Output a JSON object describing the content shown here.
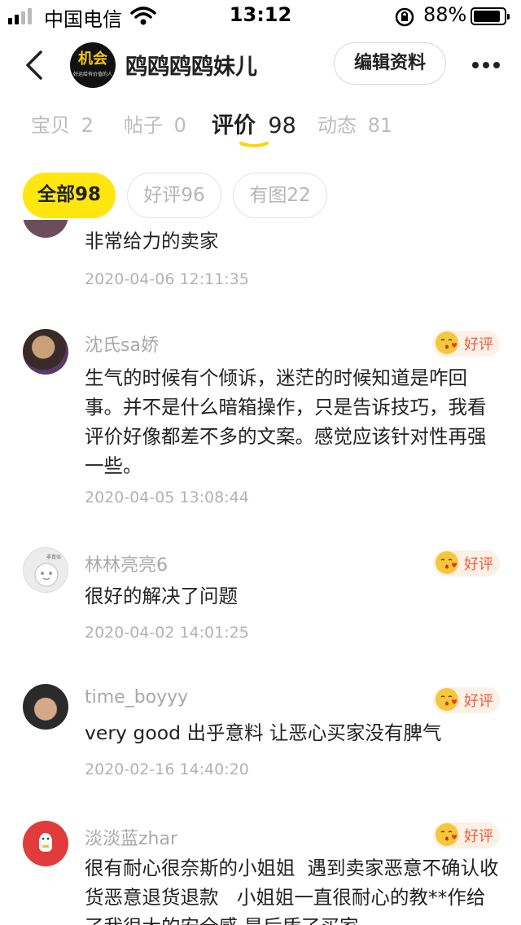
{
  "status_bar": {
    "carrier": "中国电信",
    "time": "13:12",
    "battery_percent": "88%",
    "battery_level": 0.88,
    "icons": [
      "signal-icon",
      "wifi-icon",
      "orientation-lock-icon",
      "battery-icon"
    ]
  },
  "header": {
    "shop_name": "鸥鸥鸥鸥妹儿",
    "avatar_text": "机会",
    "avatar_subtext": "好运给有价值的人",
    "edit_button": "编辑资料",
    "icons": [
      "back-arrow-icon",
      "more-dots-icon"
    ]
  },
  "tabs": [
    {
      "label": "宝贝",
      "count": "2"
    },
    {
      "label": "帖子",
      "count": "0"
    },
    {
      "label": "评价",
      "count": "98",
      "active": true
    },
    {
      "label": "动态",
      "count": "81"
    }
  ],
  "filters": [
    {
      "label": "全部98",
      "active": true
    },
    {
      "label": "好评96",
      "active": false
    },
    {
      "label": "有图22",
      "active": false
    }
  ],
  "reviews": [
    {
      "name": "",
      "text": "非常给力的卖家",
      "date": "2020-04-06 12:11:35",
      "badge": ""
    },
    {
      "name": "沈氏sa娇",
      "text": "生气的时候有个倾诉，迷茫的时候知道是咋回事。并不是什么暗箱操作，只是告诉技巧，我看评价好像都差不多的文案。感觉应该针对性再强一些。",
      "date": "2020-04-05 13:08:44",
      "badge": "好评"
    },
    {
      "name": "林林亮亮6",
      "text": "很好的解决了问题",
      "date": "2020-04-02 14:01:25",
      "badge": "好评",
      "avatar_caption": "非真似"
    },
    {
      "name": "time_boyyy",
      "text": "very good 出乎意料 让恶心买家没有脾气",
      "date": "2020-02-16 14:40:20",
      "badge": "好评"
    },
    {
      "name": "淡淡蓝zhar",
      "text": "很有耐心很奈斯的小姐姐  遇到卖家恶意不确认收货恶意退货退款   小姐姐一直很耐心的教**作给了我很大的安全感 是后盾了买家",
      "date": "",
      "badge": "好评"
    }
  ],
  "colors": {
    "accent_yellow": "#ffe60f",
    "badge_text": "#f05a3a",
    "badge_bg": "#fdf0e6"
  }
}
